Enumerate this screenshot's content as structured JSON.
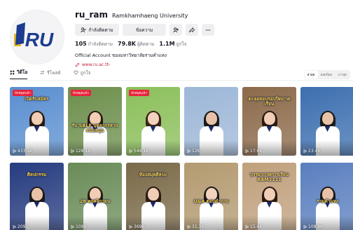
{
  "profile": {
    "username": "ru_ram",
    "nickname": "Ramkhamhaeng University",
    "follow_label": "กำลังติดตาม",
    "message_label": "ข้อความ",
    "avatar_text": "RU",
    "stats": [
      {
        "value": "105",
        "label": "กำลังติดตาม"
      },
      {
        "value": "79.8K",
        "label": "ผู้ติดตาม"
      },
      {
        "value": "1.1M",
        "label": "ถูกใจ"
      }
    ],
    "bio": "Official Account ของมหาวิทยาลัยรามคำแหง",
    "link": "www.ru.ac.th"
  },
  "tabs": [
    {
      "label": "วิดีโอ",
      "active": true
    },
    {
      "label": "รีโพสต์",
      "active": false
    },
    {
      "label": "ถูกใจ",
      "active": false
    }
  ],
  "sort": [
    "ล่าสุด",
    "ยอดนิยม",
    "เก่าสุด"
  ],
  "videos": [
    {
      "views": "433.1K",
      "overlay": "เปิดรับสมัคร",
      "badge": "ปักหมุดแล้ว",
      "bg": "#5a8fd0",
      "hair": "#2a1a12",
      "skin": "#f0cdb4"
    },
    {
      "views": "128.1K",
      "overlay": "รับ SALE บุคลากรสายสนับสนุน",
      "badge": "ปักหมุดแล้ว",
      "bg": "#6d8f4c",
      "hair": "#2a1a12",
      "skin": "#f0cdb4"
    },
    {
      "views": "544.1K",
      "overlay": "",
      "badge": "ปักหมุดแล้ว",
      "bg": "#8bbf5a",
      "hair": "#3a2418",
      "skin": "#f2d2bc"
    },
    {
      "views": "12K",
      "overlay": "",
      "badge": "",
      "bg": "#9db7d8",
      "hair": "#1a1a1a",
      "skin": "#e8c2a8"
    },
    {
      "views": "17.6K",
      "overlay": "ตะลุยสอบรอบปิดภาคเรียน",
      "badge": "",
      "bg": "#8c6a4a",
      "hair": "#2a1a12",
      "skin": "#f0cdb4"
    },
    {
      "views": "23.4K",
      "overlay": "",
      "badge": "",
      "bg": "#3d6fb0",
      "hair": "#1a1a1a",
      "skin": "#e8c2a8"
    },
    {
      "views": "2093",
      "overlay": "ศิลปกรรม",
      "badge": "",
      "bg": "#263c80",
      "hair": "#1a1a1a",
      "skin": "#e8c2a8"
    },
    {
      "views": "1099",
      "overlay": "28 พฤศจิกายน",
      "badge": "",
      "bg": "#6a8c58",
      "hair": "#2a1a12",
      "skin": "#f0cdb4"
    },
    {
      "views": "3696",
      "overlay": "ห้องสมุดศิลปะ",
      "badge": "",
      "bg": "#7a6a48",
      "hair": "#2a1a12",
      "skin": "#f0cdb4"
    },
    {
      "views": "31.3K",
      "overlay": "Q&A ตอบคำถาม",
      "badge": "",
      "bg": "#b39a70",
      "hair": "#1a1a1a",
      "skin": "#f2d2bc"
    },
    {
      "views": "15.4K",
      "overlay": "บรรยากาศการเรียน RAM1111",
      "badge": "",
      "bg": "#c0a07c",
      "hair": "#2a1a12",
      "skin": "#f0cdb4"
    },
    {
      "views": "108.6K",
      "overlay": "รามคำแหง",
      "badge": "",
      "bg": "#5a7fbf",
      "hair": "#1a1a1a",
      "skin": "#e8c2a8"
    }
  ],
  "colors": {
    "accent": "#c21f3a",
    "text": "#161823",
    "muted": "#73757c"
  }
}
